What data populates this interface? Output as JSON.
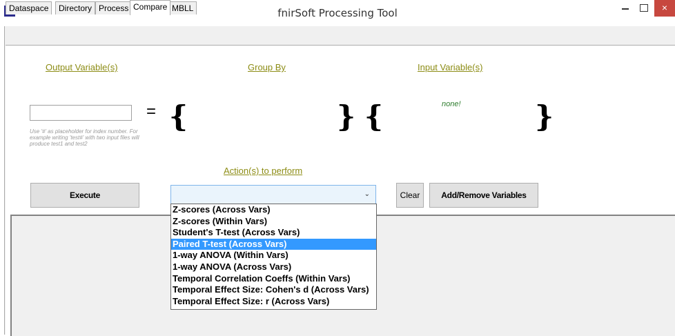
{
  "window": {
    "title": "fnirSoft Processing Tool",
    "close_symbol": "×",
    "minimize_icon": "minimize-icon",
    "maximize_icon": "maximize-icon",
    "close_color": "#c7483f"
  },
  "tabs": [
    {
      "label": "Dataspace",
      "active": false
    },
    {
      "label": "Directory",
      "active": false
    },
    {
      "label": "Process",
      "active": false
    },
    {
      "label": "Compare",
      "active": true
    },
    {
      "label": "MBLL",
      "active": false
    }
  ],
  "labels": {
    "output_variables": "Output Variable(s)",
    "group_by": "Group By",
    "input_variables": "Input Variable(s)",
    "actions": "Action(s) to perform",
    "link_color": "#8c8c14"
  },
  "output_input": {
    "value": "",
    "placeholder": ""
  },
  "hint": "Use '#' as placeholder for index number. For example writing 'test#' with two input files will produce test1 and test2",
  "equals": "=",
  "braces": {
    "open": "{",
    "close": "}"
  },
  "input_none": "none!",
  "buttons": {
    "execute": "Execute",
    "clear": "Clear",
    "add_remove": "Add/Remove Variables"
  },
  "combo": {
    "value": "",
    "arrow": "⌄"
  },
  "dropdown_items": [
    "Z-scores (Across Vars)",
    "Z-scores (Within Vars)",
    "Student's T-test (Across Vars)",
    "Paired T-test (Across Vars)",
    "1-way ANOVA (Within Vars)",
    "1-way ANOVA (Across Vars)",
    "Temporal Correlation Coeffs (Within Vars)",
    "Temporal Effect Size: Cohen's d (Across Vars)",
    "Temporal Effect Size: r (Across Vars)"
  ],
  "dropdown_selected_index": 3,
  "selection_color": "#3399ff"
}
